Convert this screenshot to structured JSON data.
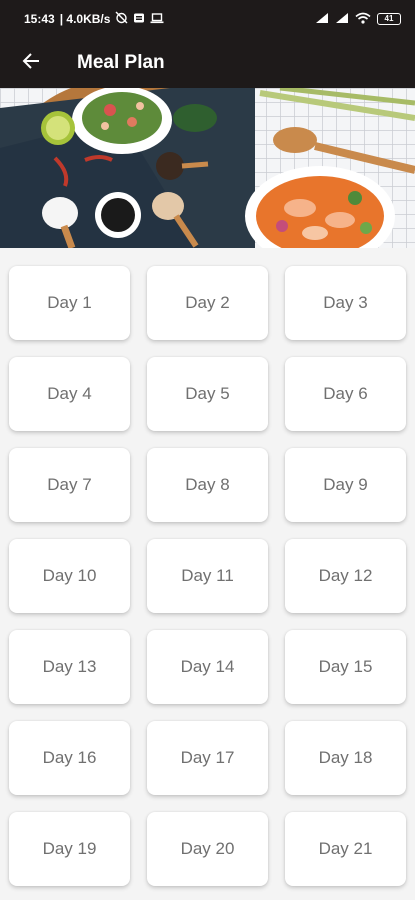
{
  "status_bar": {
    "time": "15:43",
    "net_speed": "| 4.0KB/s",
    "battery": "41",
    "icons": [
      "alarm-off-icon",
      "notification-icon",
      "laptop-icon",
      "signal-icon",
      "signal-icon",
      "wifi-icon",
      "battery-icon"
    ]
  },
  "app_bar": {
    "title": "Meal Plan",
    "back_icon": "arrow-back-icon"
  },
  "hero": {
    "description_icon": "food-banner-image"
  },
  "days": [
    "Day 1",
    "Day 2",
    "Day 3",
    "Day 4",
    "Day 5",
    "Day 6",
    "Day 7",
    "Day 8",
    "Day 9",
    "Day 10",
    "Day 11",
    "Day 12",
    "Day 13",
    "Day 14",
    "Day 15",
    "Day 16",
    "Day 17",
    "Day 18",
    "Day 19",
    "Day 20",
    "Day 21"
  ],
  "colors": {
    "app_bar": "#1e1a1a",
    "background": "#f4f4f4",
    "card": "#ffffff",
    "card_text": "#707070"
  }
}
